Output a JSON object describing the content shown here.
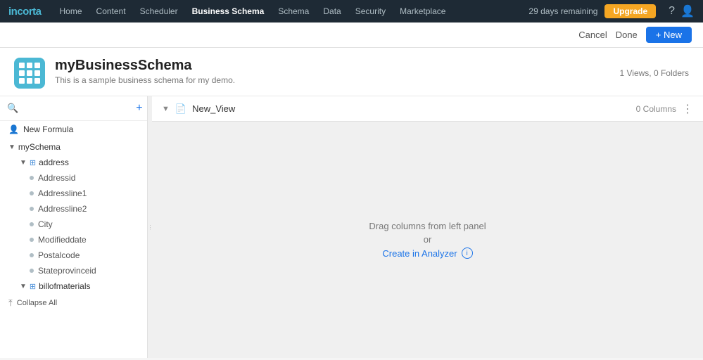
{
  "nav": {
    "logo": "incorta",
    "links": [
      {
        "label": "Home",
        "active": false
      },
      {
        "label": "Content",
        "active": false
      },
      {
        "label": "Scheduler",
        "active": false
      },
      {
        "label": "Business Schema",
        "active": true
      },
      {
        "label": "Schema",
        "active": false
      },
      {
        "label": "Data",
        "active": false
      },
      {
        "label": "Security",
        "active": false
      },
      {
        "label": "Marketplace",
        "active": false
      }
    ],
    "days_remaining": "29 days remaining",
    "upgrade_label": "Upgrade"
  },
  "subheader": {
    "cancel_label": "Cancel",
    "done_label": "Done",
    "new_label": "+ New"
  },
  "schema_header": {
    "title": "myBusinessSchema",
    "description": "This is a sample business schema for my demo.",
    "meta": "1 Views, 0 Folders"
  },
  "left_panel": {
    "search_placeholder": "",
    "formula_item": "New Formula",
    "schema_name": "mySchema",
    "address_table": "address",
    "address_columns": [
      "Addressid",
      "Addressline1",
      "Addressline2",
      "City",
      "Modifieddate",
      "Postalcode",
      "Stateprovinceid"
    ],
    "second_table": "billofmaterials",
    "collapse_all": "Collapse All"
  },
  "right_panel": {
    "view_name": "New_View",
    "columns_label": "0 Columns",
    "drop_text": "Drag columns from left panel",
    "or_text": "or",
    "create_analyzer_label": "Create in Analyzer"
  }
}
